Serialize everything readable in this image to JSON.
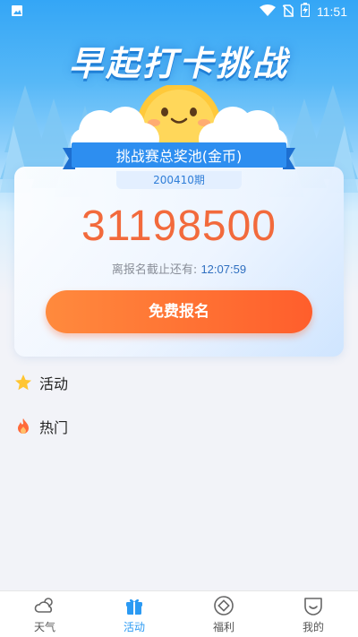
{
  "status_bar": {
    "time": "11:51",
    "icons": [
      "image-icon",
      "wifi-icon",
      "no-sim-icon",
      "battery-charging-icon"
    ]
  },
  "hero": {
    "title": "早起打卡挑战"
  },
  "prize": {
    "pool_label": "挑战赛总奖池(金币)",
    "period": "200410期",
    "amount": "31198500",
    "deadline_label": "离报名截止还有:",
    "countdown": "12:07:59",
    "signup_label": "免费报名"
  },
  "sections": [
    {
      "icon": "star-icon",
      "label": "活动"
    },
    {
      "icon": "fire-icon",
      "label": "热门"
    }
  ],
  "nav": {
    "items": [
      {
        "icon": "weather-icon",
        "label": "天气"
      },
      {
        "icon": "gift-icon",
        "label": "活动"
      },
      {
        "icon": "coin-icon",
        "label": "福利"
      },
      {
        "icon": "profile-icon",
        "label": "我的"
      }
    ],
    "active_index": 1
  },
  "colors": {
    "accent_blue": "#2b9af3",
    "prize_orange": "#f26a3c",
    "button_gradient_start": "#ff8a3d",
    "button_gradient_end": "#ff5e2c"
  }
}
